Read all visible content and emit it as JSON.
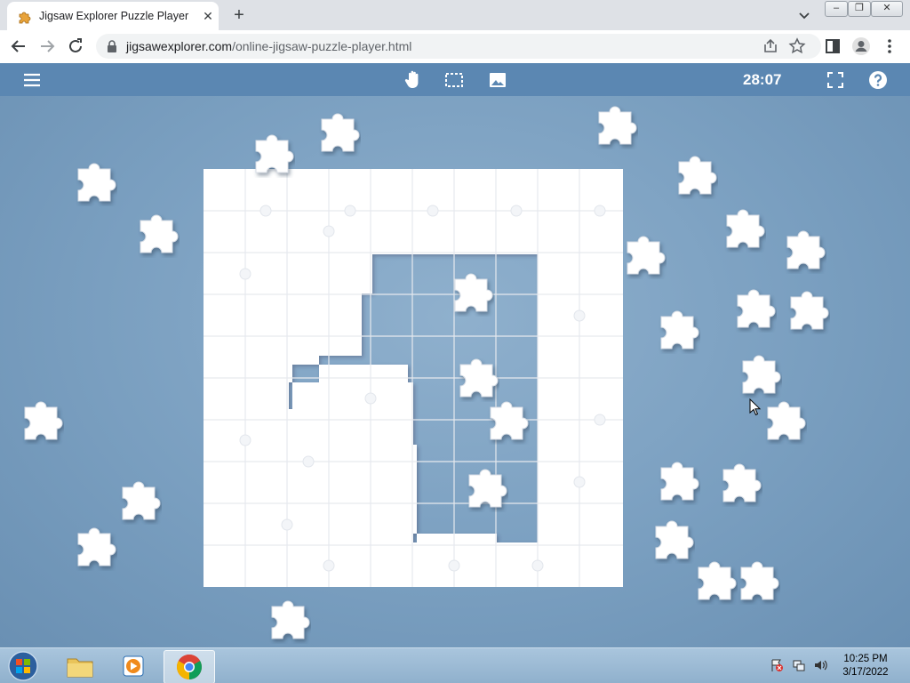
{
  "browser": {
    "tab_title": "Jigsaw Explorer Puzzle Player",
    "url_host": "jigsawexplorer.com",
    "url_path": "/online-jigsaw-puzzle-player.html"
  },
  "app": {
    "timer": "28:07",
    "toolbar_icons": [
      "menu-icon",
      "hand-icon",
      "box-select-icon",
      "image-preview-icon",
      "fullscreen-icon",
      "help-icon"
    ]
  },
  "taskbar": {
    "time": "10:25 PM",
    "date": "3/17/2022",
    "apps": [
      "file-explorer-icon",
      "media-player-icon",
      "chrome-icon"
    ]
  },
  "colors": {
    "appbar": "#5b87b2",
    "table": "#7a9fc0",
    "piece": "#ffffff"
  }
}
